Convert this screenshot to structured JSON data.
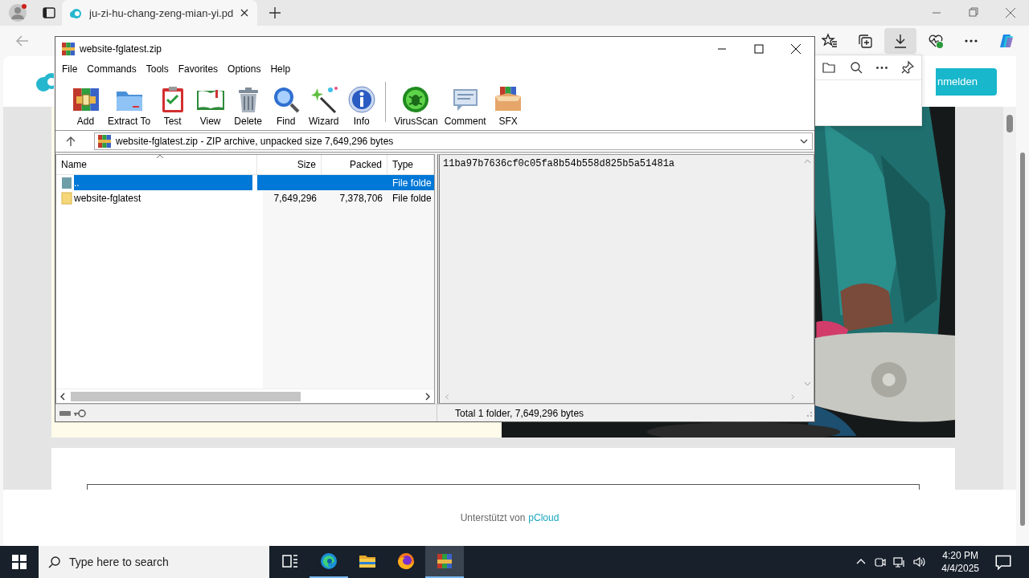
{
  "browser": {
    "tabs": [
      {
        "title": "ju-zi-hu-chang-zeng-mian-yi.pd",
        "selected": true
      }
    ],
    "toolbar": [
      {
        "kind": "favorites",
        "selected": false
      },
      {
        "kind": "collections",
        "selected": false
      },
      {
        "kind": "downloads",
        "selected": true
      },
      {
        "kind": "health",
        "selected": false
      },
      {
        "kind": "more",
        "selected": false
      },
      {
        "kind": "copilot",
        "selected": false
      }
    ],
    "page": {
      "login_button": "nmelden",
      "footer": {
        "text": "Unterstützt von",
        "link": "pCloud"
      }
    }
  },
  "winrar": {
    "title": "website-fglatest.zip",
    "menu": [
      "File",
      "Commands",
      "Tools",
      "Favorites",
      "Options",
      "Help"
    ],
    "toolbar": [
      {
        "label": "Add",
        "kind": "add"
      },
      {
        "label": "Extract To",
        "kind": "extract"
      },
      {
        "label": "Test",
        "kind": "test"
      },
      {
        "label": "View",
        "kind": "view"
      },
      {
        "label": "Delete",
        "kind": "delete"
      },
      {
        "label": "Find",
        "kind": "find"
      },
      {
        "label": "Wizard",
        "kind": "wizard"
      },
      {
        "label": "Info",
        "kind": "info"
      },
      {
        "label": "VirusScan",
        "kind": "virusscan"
      },
      {
        "label": "Comment",
        "kind": "comment"
      },
      {
        "label": "SFX",
        "kind": "sfx"
      }
    ],
    "path": "website-fglatest.zip - ZIP archive, unpacked size 7,649,296 bytes",
    "columns": [
      "Name",
      "Size",
      "Packed",
      "Type"
    ],
    "rows": [
      {
        "name": "..",
        "type": "File folde",
        "kind": "up",
        "selected": true
      },
      {
        "name": "website-fglatest",
        "size": "7,649,296",
        "packed": "7,378,706",
        "type": "File folde",
        "kind": "folder",
        "selected": false
      }
    ],
    "comment": "11ba97b7636cf0c05fa8b54b558d825b5a51481a",
    "status": "Total 1 folder, 7,649,296 bytes"
  },
  "taskbar": {
    "search_placeholder": "Type here to search",
    "apps": [
      {
        "kind": "taskview",
        "selected": false,
        "running": false
      },
      {
        "kind": "edge",
        "selected": false,
        "running": true
      },
      {
        "kind": "explorer",
        "selected": false,
        "running": false
      },
      {
        "kind": "firefox",
        "selected": false,
        "running": false
      },
      {
        "kind": "winrar",
        "selected": true,
        "running": true
      }
    ],
    "time": "4:20 PM",
    "date": "4/4/2025"
  }
}
